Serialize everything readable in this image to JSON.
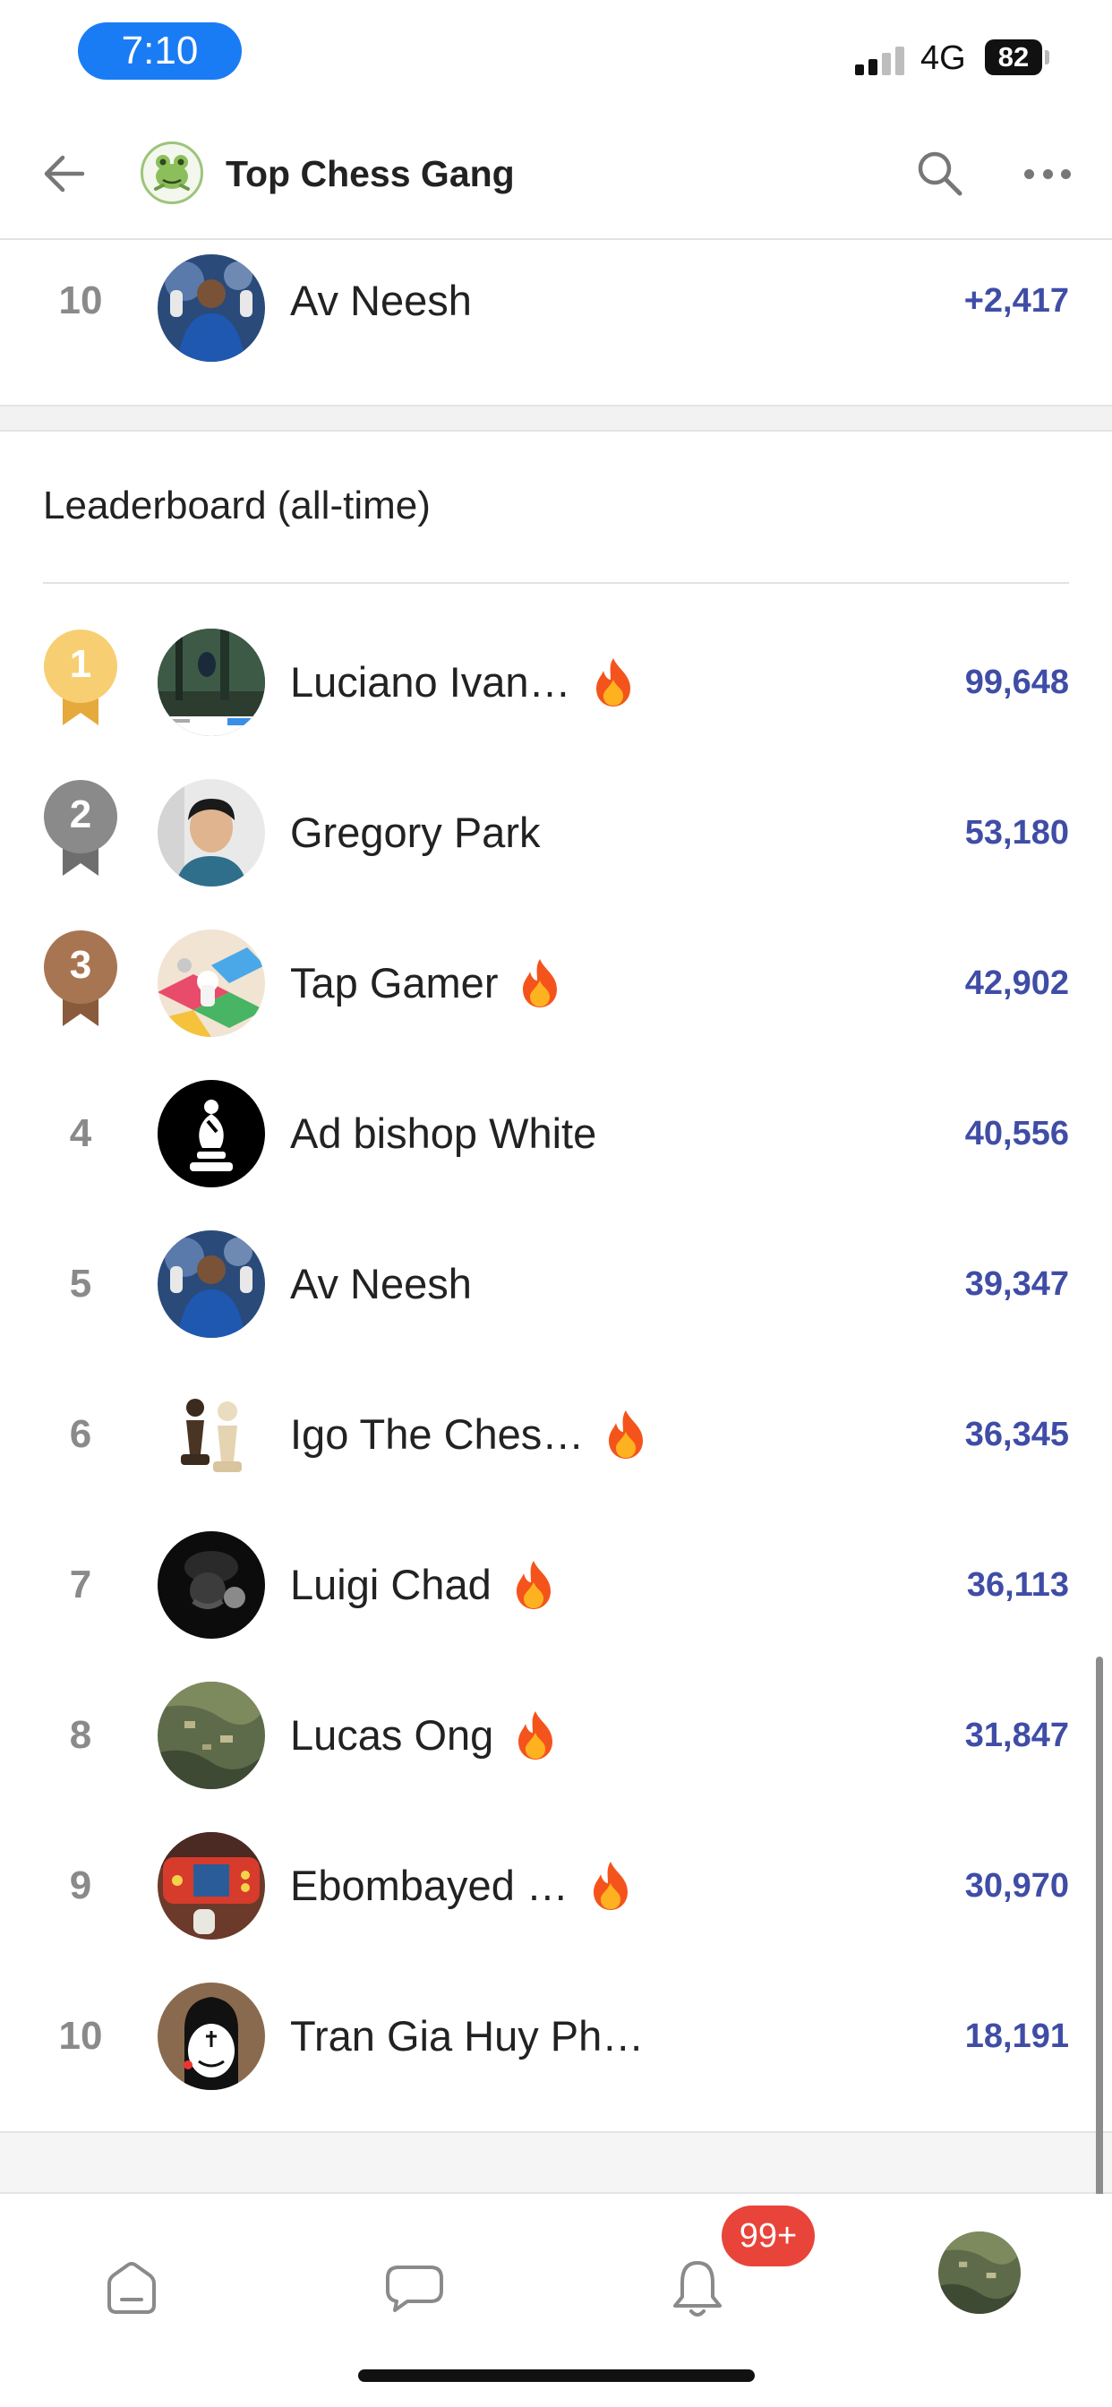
{
  "status_bar": {
    "time": "7:10",
    "network": "4G",
    "battery": "82"
  },
  "header": {
    "title": "Top Chess Gang"
  },
  "previous_section_row": {
    "rank": "10",
    "name": "Av Neesh",
    "points": "+2,417"
  },
  "leaderboard": {
    "title": "Leaderboard (all-time)",
    "rows": [
      {
        "rank": "1",
        "name": "Luciano Ivan…",
        "points": "99,648",
        "fire": true,
        "medal": "gold"
      },
      {
        "rank": "2",
        "name": "Gregory Park",
        "points": "53,180",
        "fire": false,
        "medal": "silver"
      },
      {
        "rank": "3",
        "name": "Tap Gamer",
        "points": "42,902",
        "fire": true,
        "medal": "bronze"
      },
      {
        "rank": "4",
        "name": "Ad bishop White",
        "points": "40,556",
        "fire": false
      },
      {
        "rank": "5",
        "name": "Av Neesh",
        "points": "39,347",
        "fire": false
      },
      {
        "rank": "6",
        "name": "Igo The Ches…",
        "points": "36,345",
        "fire": true
      },
      {
        "rank": "7",
        "name": "Luigi Chad",
        "points": "36,113",
        "fire": true
      },
      {
        "rank": "8",
        "name": "Lucas Ong",
        "points": "31,847",
        "fire": true
      },
      {
        "rank": "9",
        "name": "Ebombayed …",
        "points": "30,970",
        "fire": true
      },
      {
        "rank": "10",
        "name": "Tran Gia Huy Ph…",
        "points": "18,191",
        "fire": false
      }
    ]
  },
  "tabbar": {
    "notifications_badge": "99+"
  },
  "colors": {
    "accent": "#1a7cf5",
    "points": "#3f4da6",
    "badge": "#e8443a",
    "gold": "#f7cf72",
    "silver": "#8a8a8a",
    "bronze": "#a87552"
  },
  "icons": [
    "back-arrow-icon",
    "search-icon",
    "more-dots-icon",
    "fire-icon",
    "home-icon",
    "chat-icon",
    "bell-icon"
  ]
}
